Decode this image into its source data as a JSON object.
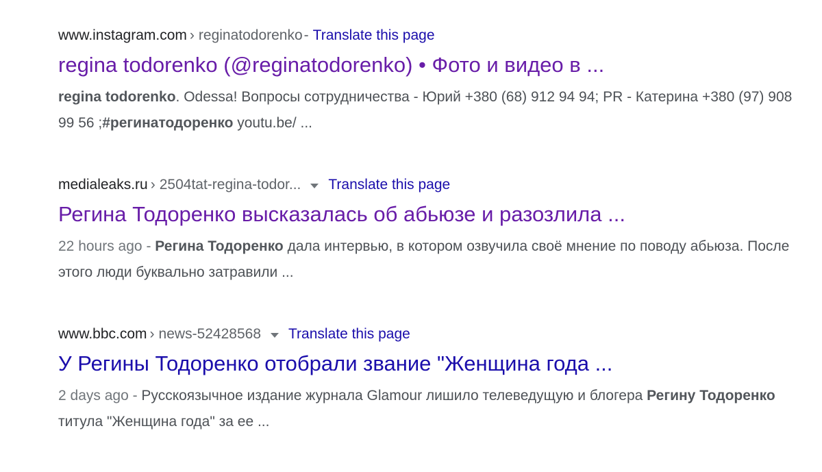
{
  "results": [
    {
      "domain": "www.instagram.com",
      "separator": "›",
      "path": "reginatodorenko",
      "dash": "-",
      "translate": "Translate this page",
      "title": "regina todorenko (@reginatodorenko) • Фото и видео в ...",
      "snippet": {
        "bold1": "regina todorenko",
        "text1": ". Odessa! Вопросы сотрудничества - Юрий +380 (68) 912 94 94; PR - Катерина +380 (97) 908 99 56 ;",
        "bold2": "#регинатодоренко",
        "text2": " youtu.be/ ..."
      }
    },
    {
      "domain": "medialeaks.ru",
      "separator": "›",
      "path": "2504tat-regina-todor...",
      "translate": "Translate this page",
      "title": "Регина Тодоренко высказалась об абьюзе и разозлила ...",
      "snippet": {
        "date": "22 hours ago",
        "dash": " - ",
        "bold1": "Регина Тодоренко",
        "text1": " дала интервью, в котором озвучила своё мнение по поводу абьюза. После этого люди буквально затравили ..."
      }
    },
    {
      "domain": "www.bbc.com",
      "separator": "›",
      "path": "news-52428568",
      "translate": "Translate this page",
      "title": "У Регины Тодоренко отобрали звание \"Женщина года ...",
      "snippet": {
        "date": "2 days ago",
        "dash": " - ",
        "text0": "Русскоязычное издание журнала Glamour лишило телеведущую и блогера ",
        "bold1": "Регину Тодоренко",
        "text1": " титула \"Женщина года\" за ее ..."
      }
    }
  ]
}
